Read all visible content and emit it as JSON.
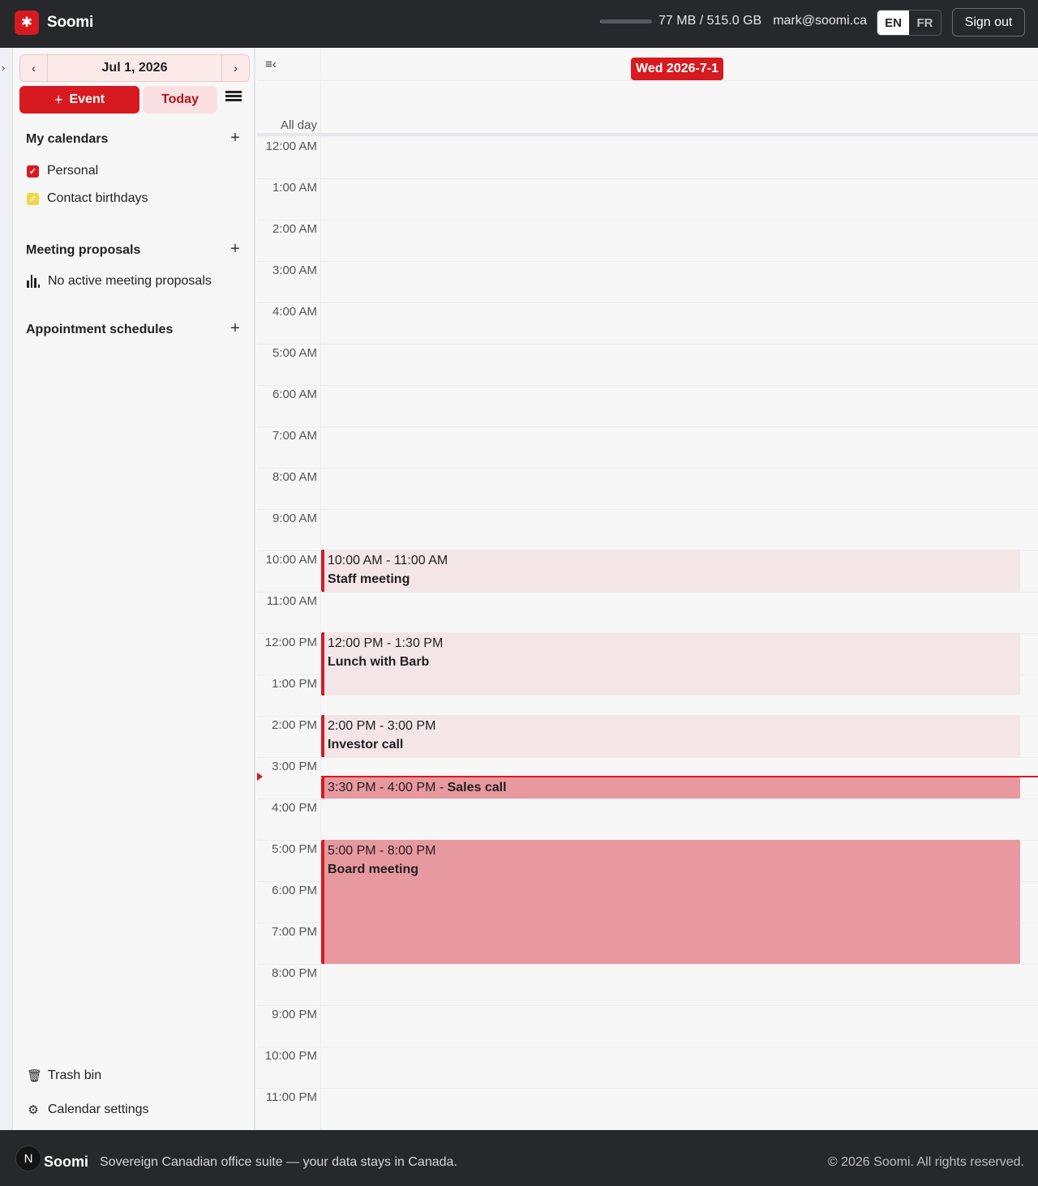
{
  "header": {
    "brand": "Soomi",
    "storage_text": "77 MB / 515.0 GB",
    "storage_used_fraction": 0.0001,
    "email": "mark@soomi.ca",
    "languages": [
      "EN",
      "FR"
    ],
    "active_language": "EN",
    "signout_label": "Sign out"
  },
  "sidebar": {
    "date_label": "Jul 1, 2026",
    "event_button": "Event",
    "today_button": "Today",
    "my_calendars_title": "My calendars",
    "calendars": [
      {
        "label": "Personal",
        "color": "#d71920"
      },
      {
        "label": "Contact birthdays",
        "color": "#f1d64a"
      }
    ],
    "meeting_proposals_title": "Meeting proposals",
    "no_proposals": "No active meeting proposals",
    "appointment_schedules_title": "Appointment schedules",
    "trash_label": "Trash bin",
    "settings_label": "Calendar settings"
  },
  "calendar": {
    "day_badge": "Wed 2026-7-1",
    "allday_label": "All day",
    "hours": [
      "12:00 AM",
      "1:00 AM",
      "2:00 AM",
      "3:00 AM",
      "4:00 AM",
      "5:00 AM",
      "6:00 AM",
      "7:00 AM",
      "8:00 AM",
      "9:00 AM",
      "10:00 AM",
      "11:00 AM",
      "12:00 PM",
      "1:00 PM",
      "2:00 PM",
      "3:00 PM",
      "4:00 PM",
      "5:00 PM",
      "6:00 PM",
      "7:00 PM",
      "8:00 PM",
      "9:00 PM",
      "10:00 PM",
      "11:00 PM"
    ],
    "events": [
      {
        "time": "10:00 AM - 11:00 AM",
        "title": "Staff meeting"
      },
      {
        "time": "12:00 PM - 1:30 PM",
        "title": "Lunch with Barb"
      },
      {
        "time": "2:00 PM - 3:00 PM",
        "title": "Investor call"
      },
      {
        "time": "3:30 PM - 4:00 PM - ",
        "title": "Sales call"
      },
      {
        "time": "5:00 PM - 8:00 PM",
        "title": "Board meeting"
      }
    ]
  },
  "footer": {
    "logo_letter": "N",
    "brand": "Soomi",
    "tagline": "Sovereign Canadian office suite — your data stays in Canada.",
    "copyright": "© 2026 Soomi. All rights reserved."
  },
  "colors": {
    "brand_red": "#d71920",
    "topbar": "#26282c",
    "event_light": "#f4e5e7",
    "event_dark": "#e8989f"
  }
}
